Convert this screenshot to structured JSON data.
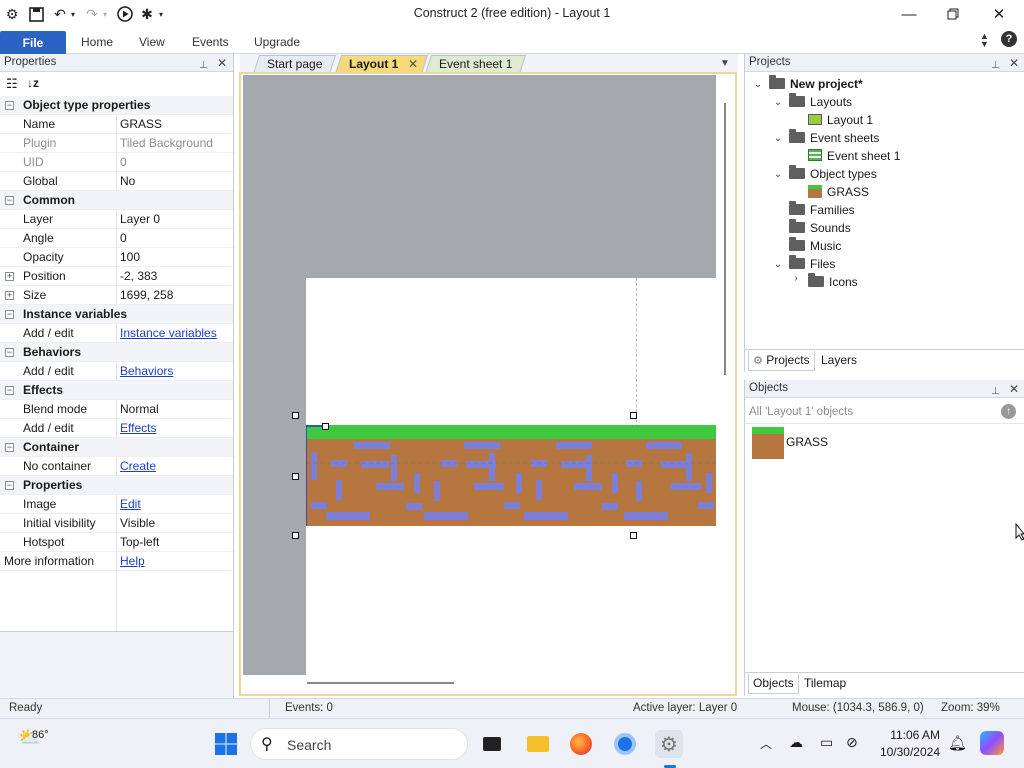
{
  "window": {
    "title": "Construct 2  (free edition) - Layout 1"
  },
  "ribbon": {
    "file": "File",
    "tabs": [
      "Home",
      "View",
      "Events",
      "Upgrade"
    ]
  },
  "properties": {
    "title": "Properties",
    "sections": {
      "object_type": "Object type properties",
      "common": "Common",
      "instance_vars": "Instance variables",
      "behaviors": "Behaviors",
      "effects": "Effects",
      "container": "Container",
      "properties": "Properties"
    },
    "rows": {
      "name_k": "Name",
      "name_v": "GRASS",
      "plugin_k": "Plugin",
      "plugin_v": "Tiled Background",
      "uid_k": "UID",
      "uid_v": "0",
      "global_k": "Global",
      "global_v": "No",
      "layer_k": "Layer",
      "layer_v": "Layer 0",
      "angle_k": "Angle",
      "angle_v": "0",
      "opacity_k": "Opacity",
      "opacity_v": "100",
      "position_k": "Position",
      "position_v": "-2, 383",
      "size_k": "Size",
      "size_v": "1699, 258",
      "iv_k": "Add / edit",
      "iv_v": "Instance variables",
      "beh_k": "Add / edit",
      "beh_v": "Behaviors",
      "blend_k": "Blend mode",
      "blend_v": "Normal",
      "fx_k": "Add / edit",
      "fx_v": "Effects",
      "cont_k": "No container",
      "cont_v": "Create",
      "image_k": "Image",
      "image_v": "Edit",
      "vis_k": "Initial visibility",
      "vis_v": "Visible",
      "hot_k": "Hotspot",
      "hot_v": "Top-left",
      "more_k": "More information",
      "more_v": "Help"
    }
  },
  "doc_tabs": [
    "Start page",
    "Layout 1",
    "Event sheet 1"
  ],
  "projects": {
    "title": "Projects",
    "root": "New project*",
    "items": {
      "layouts": "Layouts",
      "layout1": "Layout 1",
      "eventsheets": "Event sheets",
      "eventsheet1": "Event sheet 1",
      "objecttypes": "Object types",
      "grass": "GRASS",
      "families": "Families",
      "sounds": "Sounds",
      "music": "Music",
      "files": "Files",
      "icons": "Icons"
    },
    "tabs": [
      "Projects",
      "Layers"
    ]
  },
  "objects": {
    "title": "Objects",
    "filter": "All 'Layout 1' objects",
    "item": "GRASS",
    "tabs": [
      "Objects",
      "Tilemap"
    ]
  },
  "status": {
    "ready": "Ready",
    "events": "Events: 0",
    "active_layer": "Active layer: Layer 0",
    "mouse": "Mouse: (1034.3, 586.9, 0)",
    "zoom": "Zoom: 39%"
  },
  "taskbar": {
    "temp": "86°",
    "search": "Search",
    "time": "11:06 AM",
    "date": "10/30/2024"
  },
  "colors": {
    "file_tab": "#2b63c2",
    "grass": "#3ec93e",
    "dirt": "#b5763f",
    "stone": "#7d7ed8",
    "active_tab": "#f6d97a"
  }
}
